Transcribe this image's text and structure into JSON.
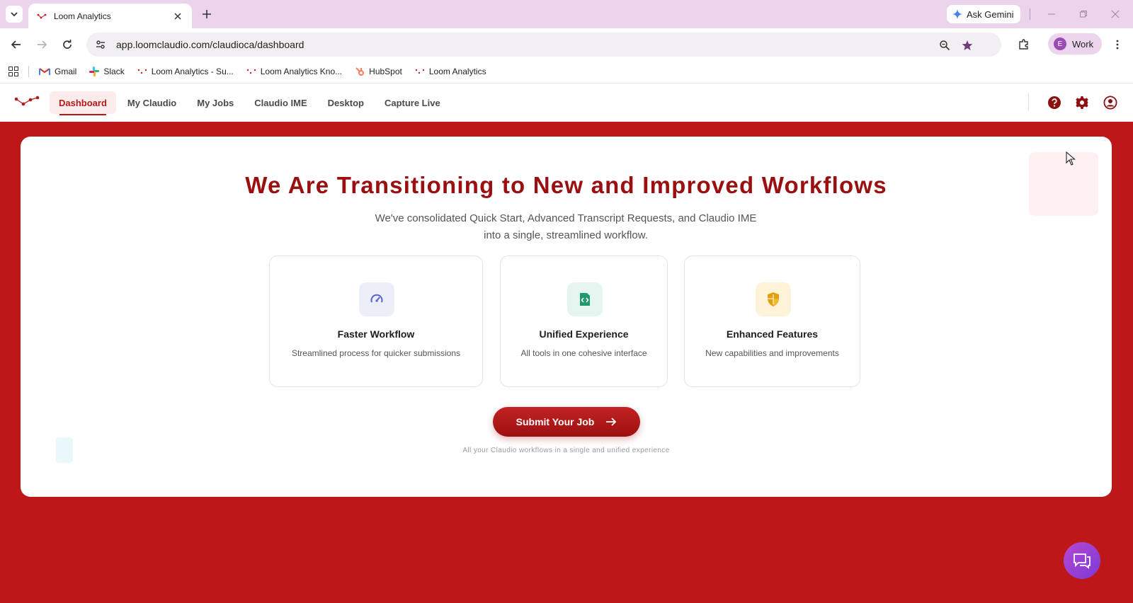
{
  "browser": {
    "tab_title": "Loom Analytics",
    "ask_gemini": "Ask Gemini",
    "url": "app.loomclaudio.com/claudioca/dashboard",
    "profile_initial": "E",
    "profile_label": "Work",
    "bookmarks": [
      {
        "label": "Gmail",
        "icon": "gmail-icon"
      },
      {
        "label": "Slack",
        "icon": "slack-icon"
      },
      {
        "label": "Loom Analytics - Su...",
        "icon": "loom-icon"
      },
      {
        "label": "Loom Analytics Kno...",
        "icon": "loom-icon"
      },
      {
        "label": "HubSpot",
        "icon": "hubspot-icon"
      },
      {
        "label": "Loom Analytics",
        "icon": "loom-icon"
      }
    ]
  },
  "nav": {
    "items": [
      {
        "label": "Dashboard",
        "active": true
      },
      {
        "label": "My Claudio",
        "active": false
      },
      {
        "label": "My Jobs",
        "active": false
      },
      {
        "label": "Claudio IME",
        "active": false
      },
      {
        "label": "Desktop",
        "active": false
      },
      {
        "label": "Capture Live",
        "active": false
      }
    ],
    "icons": [
      "help-icon",
      "gear-icon",
      "account-icon"
    ]
  },
  "hero": {
    "title": "We Are Transitioning to New and Improved Workflows",
    "subtitle_line1": "We've consolidated Quick Start, Advanced Transcript Requests, and Claudio IME",
    "subtitle_line2": "into a single, streamlined workflow."
  },
  "features": [
    {
      "title": "Faster Workflow",
      "description": "Streamlined process for quicker submissions",
      "icon": "speedometer-icon",
      "icon_bg": "#eceef8",
      "icon_color": "#5b64c8"
    },
    {
      "title": "Unified Experience",
      "description": "All tools in one cohesive interface",
      "icon": "code-file-icon",
      "icon_bg": "#e4f6ef",
      "icon_color": "#1f9a6a"
    },
    {
      "title": "Enhanced Features",
      "description": "New capabilities and improvements",
      "icon": "shield-icon",
      "icon_bg": "#fdf3d9",
      "icon_color": "#e2a011"
    }
  ],
  "cta": {
    "label": "Submit Your Job",
    "footnote": "All your Claudio workflows in a single and unified experience"
  },
  "colors": {
    "brand": "#bd1717",
    "headline": "#9a1010",
    "chrome_tabstrip": "#ecd5ec"
  }
}
